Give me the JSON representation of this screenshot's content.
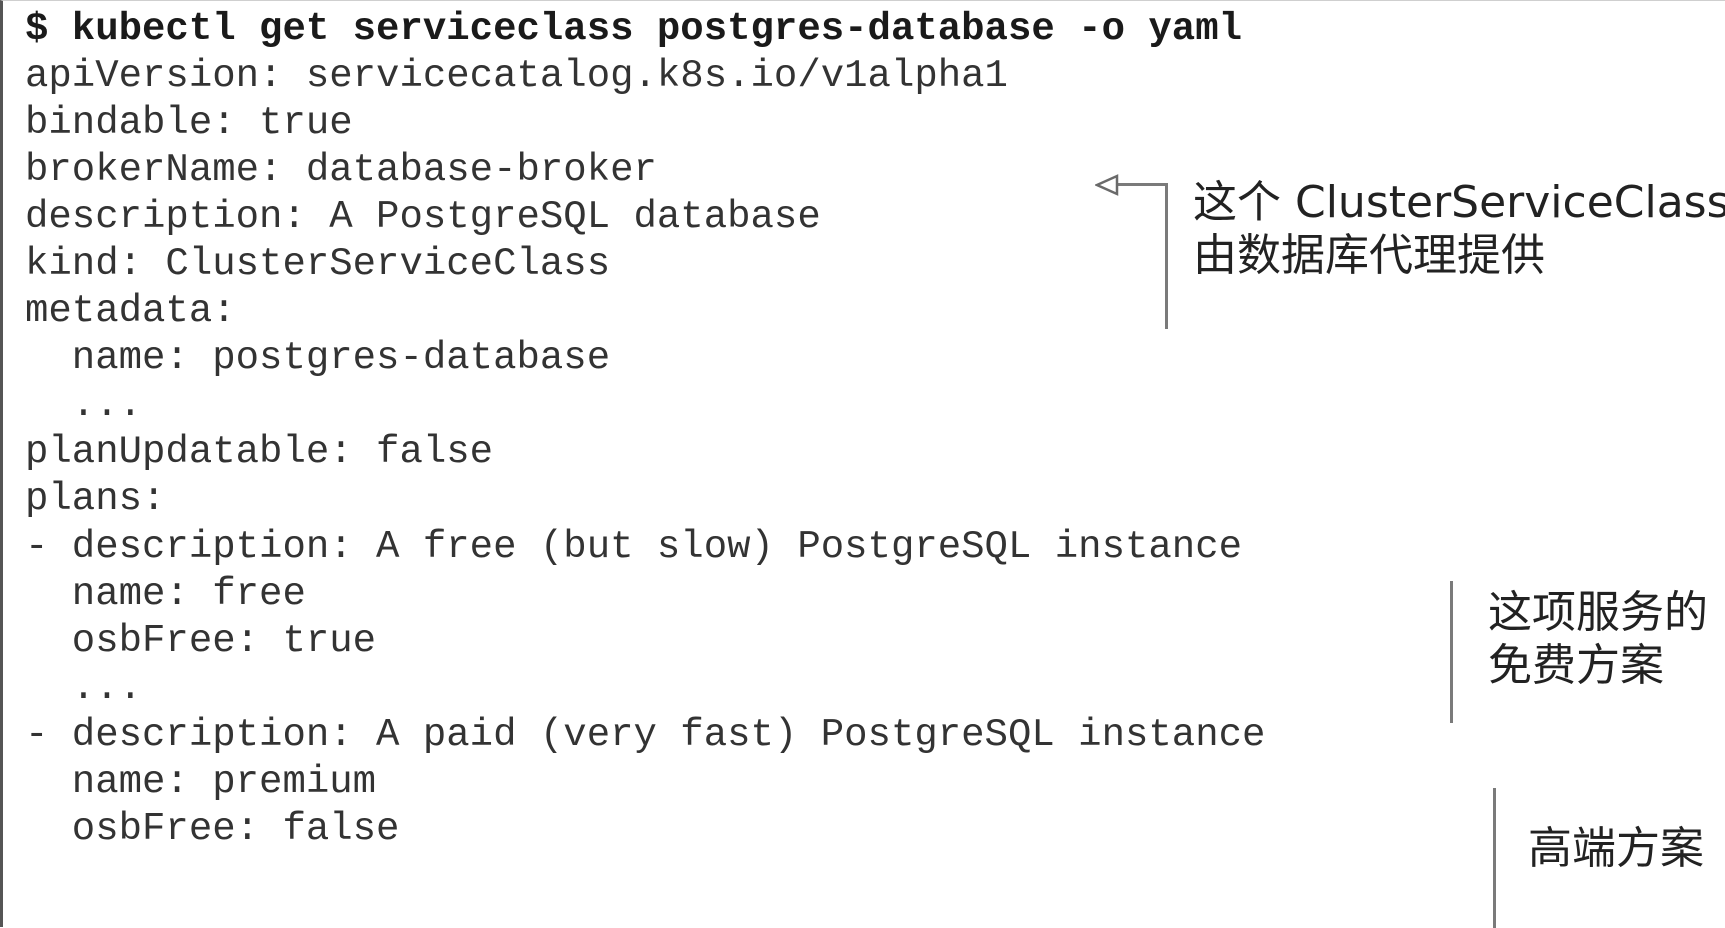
{
  "listing": {
    "command": "$ kubectl get serviceclass postgres-database -o yaml",
    "lines": [
      "apiVersion: servicecatalog.k8s.io/v1alpha1",
      "bindable: true",
      "brokerName: database-broker",
      "description: A PostgreSQL database",
      "kind: ClusterServiceClass",
      "metadata:",
      "  name: postgres-database",
      "  ...",
      "planUpdatable: false",
      "plans:",
      "- description: A free (but slow) PostgreSQL instance",
      "  name: free",
      "  osbFree: true",
      "  ...",
      "- description: A paid (very fast) PostgreSQL instance",
      "  name: premium",
      "  osbFree: false"
    ]
  },
  "annotations": {
    "broker_note": {
      "line1": "这个 ClusterServiceClass",
      "line2": "由数据库代理提供"
    },
    "free_plan_note": {
      "line1": "这项服务的",
      "line2": "免费方案"
    },
    "premium_plan_note": {
      "line1": "高端方案"
    }
  }
}
